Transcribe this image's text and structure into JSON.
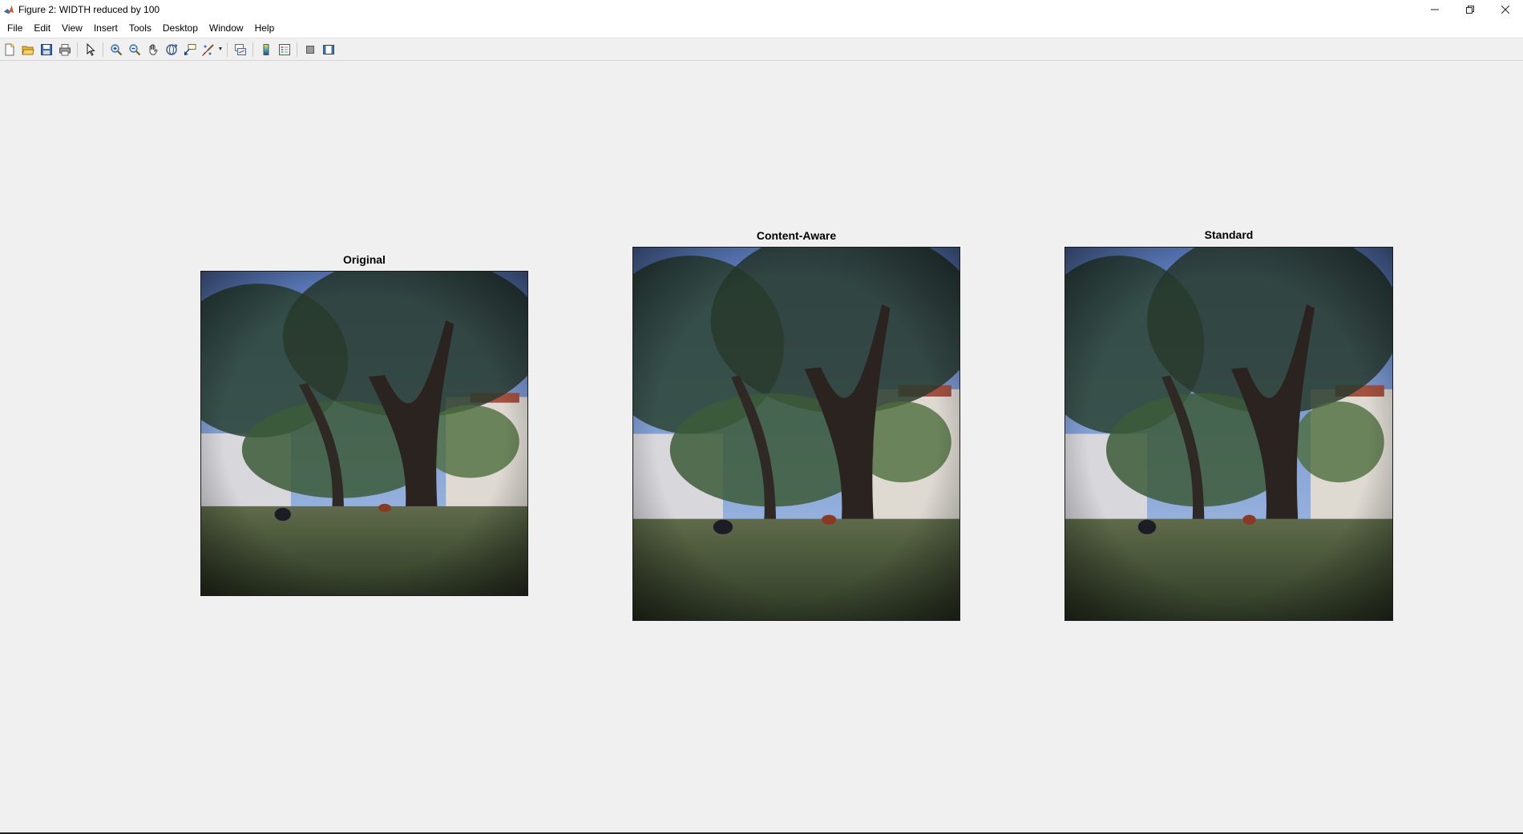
{
  "window": {
    "title": "Figure 2: WIDTH reduced by 100",
    "controls": [
      "minimize-icon",
      "restore-icon",
      "close-icon"
    ]
  },
  "menu": {
    "items": [
      "File",
      "Edit",
      "View",
      "Insert",
      "Tools",
      "Desktop",
      "Window",
      "Help"
    ]
  },
  "toolbar": {
    "buttons": [
      "new-figure-icon",
      "open-file-icon",
      "save-icon",
      "print-icon",
      "edit-plot-arrow-icon",
      "zoom-in-icon",
      "zoom-out-icon",
      "pan-hand-icon",
      "rotate-3d-icon",
      "data-cursor-icon",
      "brush-icon",
      "link-plot-icon",
      "insert-colorbar-icon",
      "insert-legend-icon",
      "hide-plot-tools-icon",
      "show-plot-tools-icon"
    ]
  },
  "axes": [
    {
      "title": "Original"
    },
    {
      "title": "Content-Aware"
    },
    {
      "title": "Standard"
    }
  ],
  "colors": {
    "background": "#f0f0f0",
    "titlebar": "#ffffff",
    "accent_matlab": "#d9541e"
  }
}
